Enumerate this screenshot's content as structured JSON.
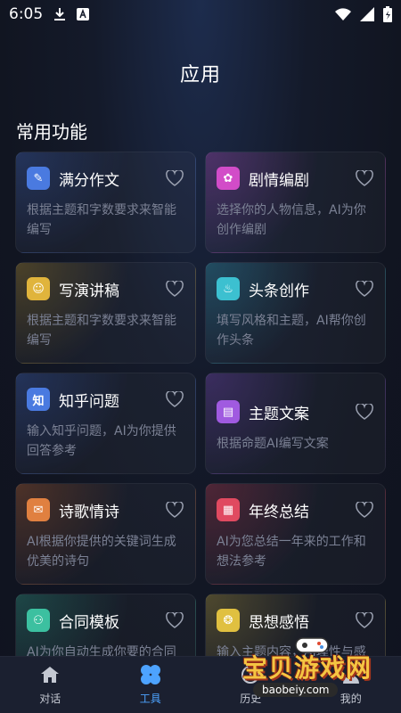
{
  "status_bar": {
    "time": "6:05",
    "icons": [
      "download-icon",
      "a-badge-icon",
      "wifi-icon",
      "signal-icon",
      "battery-icon"
    ]
  },
  "page": {
    "title": "应用",
    "section_title": "常用功能"
  },
  "colors": {
    "active_tab": "#4da3ff",
    "background": "#141a2a"
  },
  "cards": [
    {
      "title": "满分作文",
      "desc": "根据主题和字数要求来智能编写",
      "icon": "essay-icon",
      "icon_color": "#4a7ae0",
      "glyph": "✎"
    },
    {
      "title": "剧情编剧",
      "desc": "选择你的人物信息，AI为你创作编剧",
      "icon": "script-icon",
      "icon_color": "#d24cc8",
      "glyph": "✿"
    },
    {
      "title": "写演讲稿",
      "desc": "根据主题和字数要求来智能编写",
      "icon": "speech-icon",
      "icon_color": "#e0b43c",
      "glyph": "☺"
    },
    {
      "title": "头条创作",
      "desc": "填写风格和主题，AI帮你创作头条",
      "icon": "headline-icon",
      "icon_color": "#3cc0d0",
      "glyph": "♨"
    },
    {
      "title": "知乎问题",
      "desc": "输入知乎问题，AI为你提供回答参考",
      "icon": "zhihu-icon",
      "icon_color": "#4a7ae0",
      "glyph": "知"
    },
    {
      "title": "主题文案",
      "desc": "根据命题AI编写文案",
      "icon": "copywriting-icon",
      "icon_color": "#a05ae0",
      "glyph": "▤"
    },
    {
      "title": "诗歌情诗",
      "desc": "AI根据你提供的关键词生成优美的诗句",
      "icon": "poem-icon",
      "icon_color": "#e08040",
      "glyph": "✉"
    },
    {
      "title": "年终总结",
      "desc": "AI为您总结一年来的工作和想法参考",
      "icon": "summary-icon",
      "icon_color": "#e04a60",
      "glyph": "▦"
    },
    {
      "title": "合同模板",
      "desc": "AI为你自动生成你要的合同",
      "icon": "contract-icon",
      "icon_color": "#3cc0a0",
      "glyph": "⚇"
    },
    {
      "title": "思想感悟",
      "desc": "输入主题内容，AI理性与感",
      "icon": "thought-icon",
      "icon_color": "#e0c040",
      "glyph": "❂"
    }
  ],
  "bottom_nav": [
    {
      "label": "对话",
      "icon": "home-icon",
      "active": false
    },
    {
      "label": "工具",
      "icon": "tools-icon",
      "active": true
    },
    {
      "label": "历史",
      "icon": "history-icon",
      "active": false
    },
    {
      "label": "我的",
      "icon": "profile-icon",
      "active": false
    }
  ],
  "watermark": {
    "title": "宝贝游戏网",
    "url": "baobeiy.com"
  }
}
